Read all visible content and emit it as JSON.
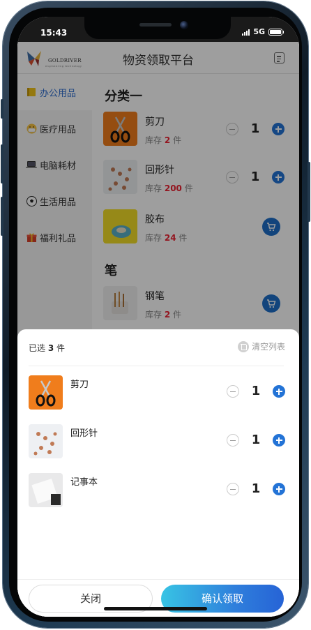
{
  "status": {
    "time": "15:43",
    "network": "5G"
  },
  "header": {
    "title": "物资领取平台",
    "logo_text": "GOLDRIVER",
    "logo_sub": "engineering technology"
  },
  "sidebar": {
    "items": [
      {
        "label": "办公用品",
        "icon": "notepad-icon",
        "active": true
      },
      {
        "label": "医疗用品",
        "icon": "mask-face-icon",
        "active": false
      },
      {
        "label": "电脑耗材",
        "icon": "laptop-icon",
        "active": false
      },
      {
        "label": "生活用品",
        "icon": "soccer-ball-icon",
        "active": false
      },
      {
        "label": "福利礼品",
        "icon": "gift-icon",
        "active": false
      }
    ]
  },
  "catalog": {
    "category1": "分类一",
    "category2": "笔",
    "stock_prefix": "库存",
    "stock_unit": "件",
    "products": [
      {
        "name": "剪刀",
        "stock": "2",
        "qty": "1"
      },
      {
        "name": "回形针",
        "stock": "200",
        "qty": "1"
      },
      {
        "name": "胶布",
        "stock": "24"
      },
      {
        "name": "钢笔",
        "stock": "2"
      }
    ]
  },
  "sheet": {
    "selected_prefix": "已选",
    "selected_count": "3",
    "selected_suffix": "件",
    "clear_label": "清空列表",
    "items": [
      {
        "name": "剪刀",
        "qty": "1"
      },
      {
        "name": "回形针",
        "qty": "1"
      },
      {
        "name": "记事本",
        "qty": "1"
      }
    ],
    "close_label": "关闭",
    "confirm_label": "确认领取"
  }
}
